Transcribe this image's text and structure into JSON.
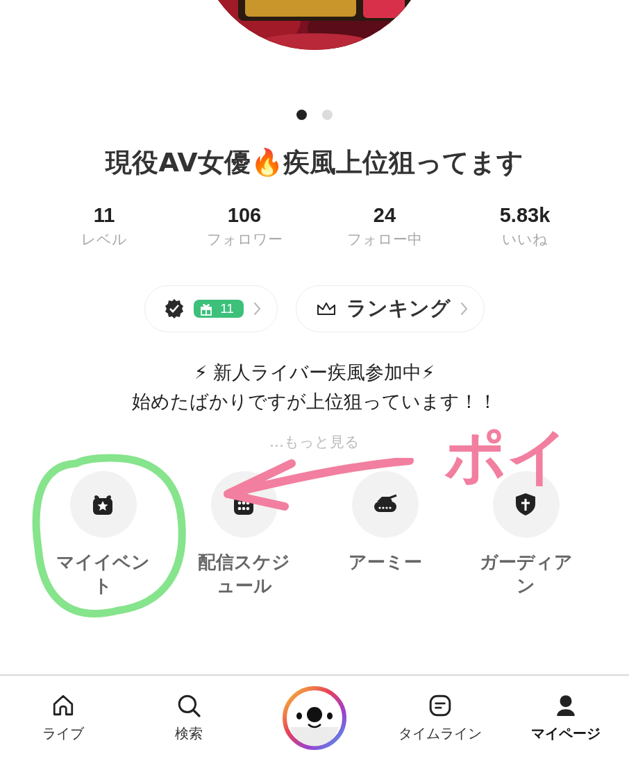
{
  "carousel": {
    "kind": "picture",
    "dots": [
      {
        "selected": true
      },
      {
        "selected": false
      }
    ]
  },
  "profile": {
    "title": "現役AV女優🔥疾風上位狙ってます"
  },
  "stats": [
    {
      "value": "11",
      "label": "レベル"
    },
    {
      "value": "106",
      "label": "フォロワー"
    },
    {
      "value": "24",
      "label": "フォロー中"
    },
    {
      "value": "5.83k",
      "label": "いいね"
    }
  ],
  "badges": [
    {
      "kind": "gift",
      "count": "11"
    },
    {
      "kind": "ranking",
      "label": "ランキング"
    }
  ],
  "bio": {
    "lines": [
      "⚡ 新人ライバー疾風参加中⚡",
      "始めたばかりですが上位狙っています！！"
    ],
    "more": "…もっと見る"
  },
  "features": [
    {
      "label": "マイイベント"
    },
    {
      "label": "配信スケジュール"
    },
    {
      "label": "アーミー"
    },
    {
      "label": "ガーディアン"
    }
  ],
  "nav": [
    {
      "kind": "tab",
      "label": "ライブ",
      "selected": false
    },
    {
      "kind": "tab",
      "label": "検索",
      "selected": false
    },
    {
      "kind": "center"
    },
    {
      "kind": "tab",
      "label": "タイムライン",
      "selected": false
    },
    {
      "kind": "tab",
      "label": "マイページ",
      "selected": true
    }
  ],
  "annotation": {
    "text": "ポイ"
  }
}
